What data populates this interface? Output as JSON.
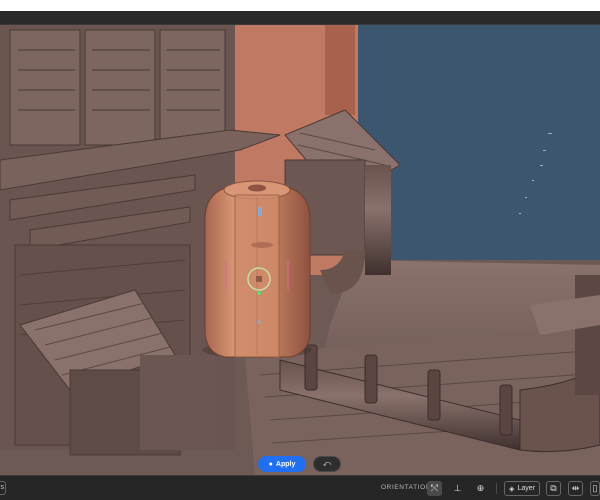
{
  "toolbar": {
    "apply_label": "Apply",
    "orientation_label": "ORIENTATION",
    "layer_label": "Layer",
    "left_tab_label": "s"
  },
  "icons": {
    "apply": "brush-icon",
    "reset": "undo-icon",
    "orientation_normal": "orientation-normal-icon",
    "orientation_axis": "orientation-axis-icon",
    "orientation_world": "globe-icon",
    "layer": "layers-icon",
    "duplicate": "duplicate-icon",
    "mirror": "mirror-icon",
    "more": "panel-icon"
  },
  "colors": {
    "accent": "#1f6ff0",
    "sky": "#3d5670",
    "clay": "#6e5a55",
    "wall_orange": "#c07a64",
    "canister": "#c98463"
  }
}
